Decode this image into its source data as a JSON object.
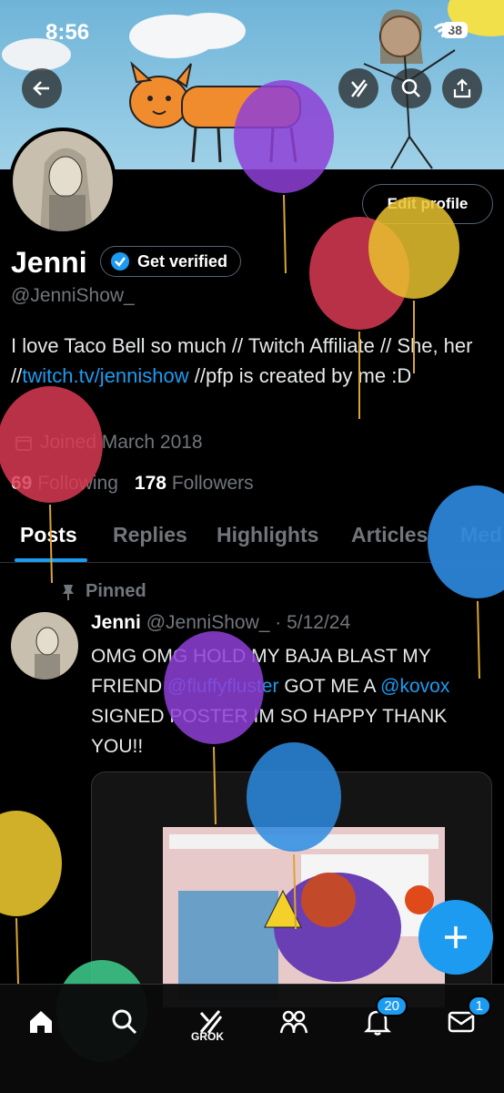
{
  "status_bar": {
    "time": "8:56",
    "battery": "38"
  },
  "profile": {
    "name": "Jenni",
    "verified_label": "Get verified",
    "handle": "@JenniShow_",
    "edit_label": "Edit profile",
    "bio_part1": "I love Taco Bell so much // Twitch Affiliate // She, her //",
    "bio_link": "twitch.tv/jennishow",
    "bio_part2": " //pfp is created by me :D",
    "joined": "Joined March 2018",
    "following_count": "69",
    "following_label": "Following",
    "followers_count": "178",
    "followers_label": "Followers"
  },
  "tabs": [
    "Posts",
    "Replies",
    "Highlights",
    "Articles",
    "Med"
  ],
  "post": {
    "pinned_label": "Pinned",
    "author": "Jenni",
    "handle_date": "@JenniShow_ · 5/12/24",
    "text1": "OMG OMG HOLD MY BAJA BLAST MY FRIEND ",
    "mention1": "@fluffyfluster",
    "text2": "  GOT ME A ",
    "mention2": "@kovox",
    "text3": " SIGNED POSTER IM SO HAPPY THANK YOU!!"
  },
  "bottom_nav": {
    "grok_label": "GROK",
    "notifications_badge": "20",
    "messages_badge": "1"
  },
  "colors": {
    "accent": "#1d9bf0",
    "background": "#000000",
    "muted": "#71767b"
  }
}
